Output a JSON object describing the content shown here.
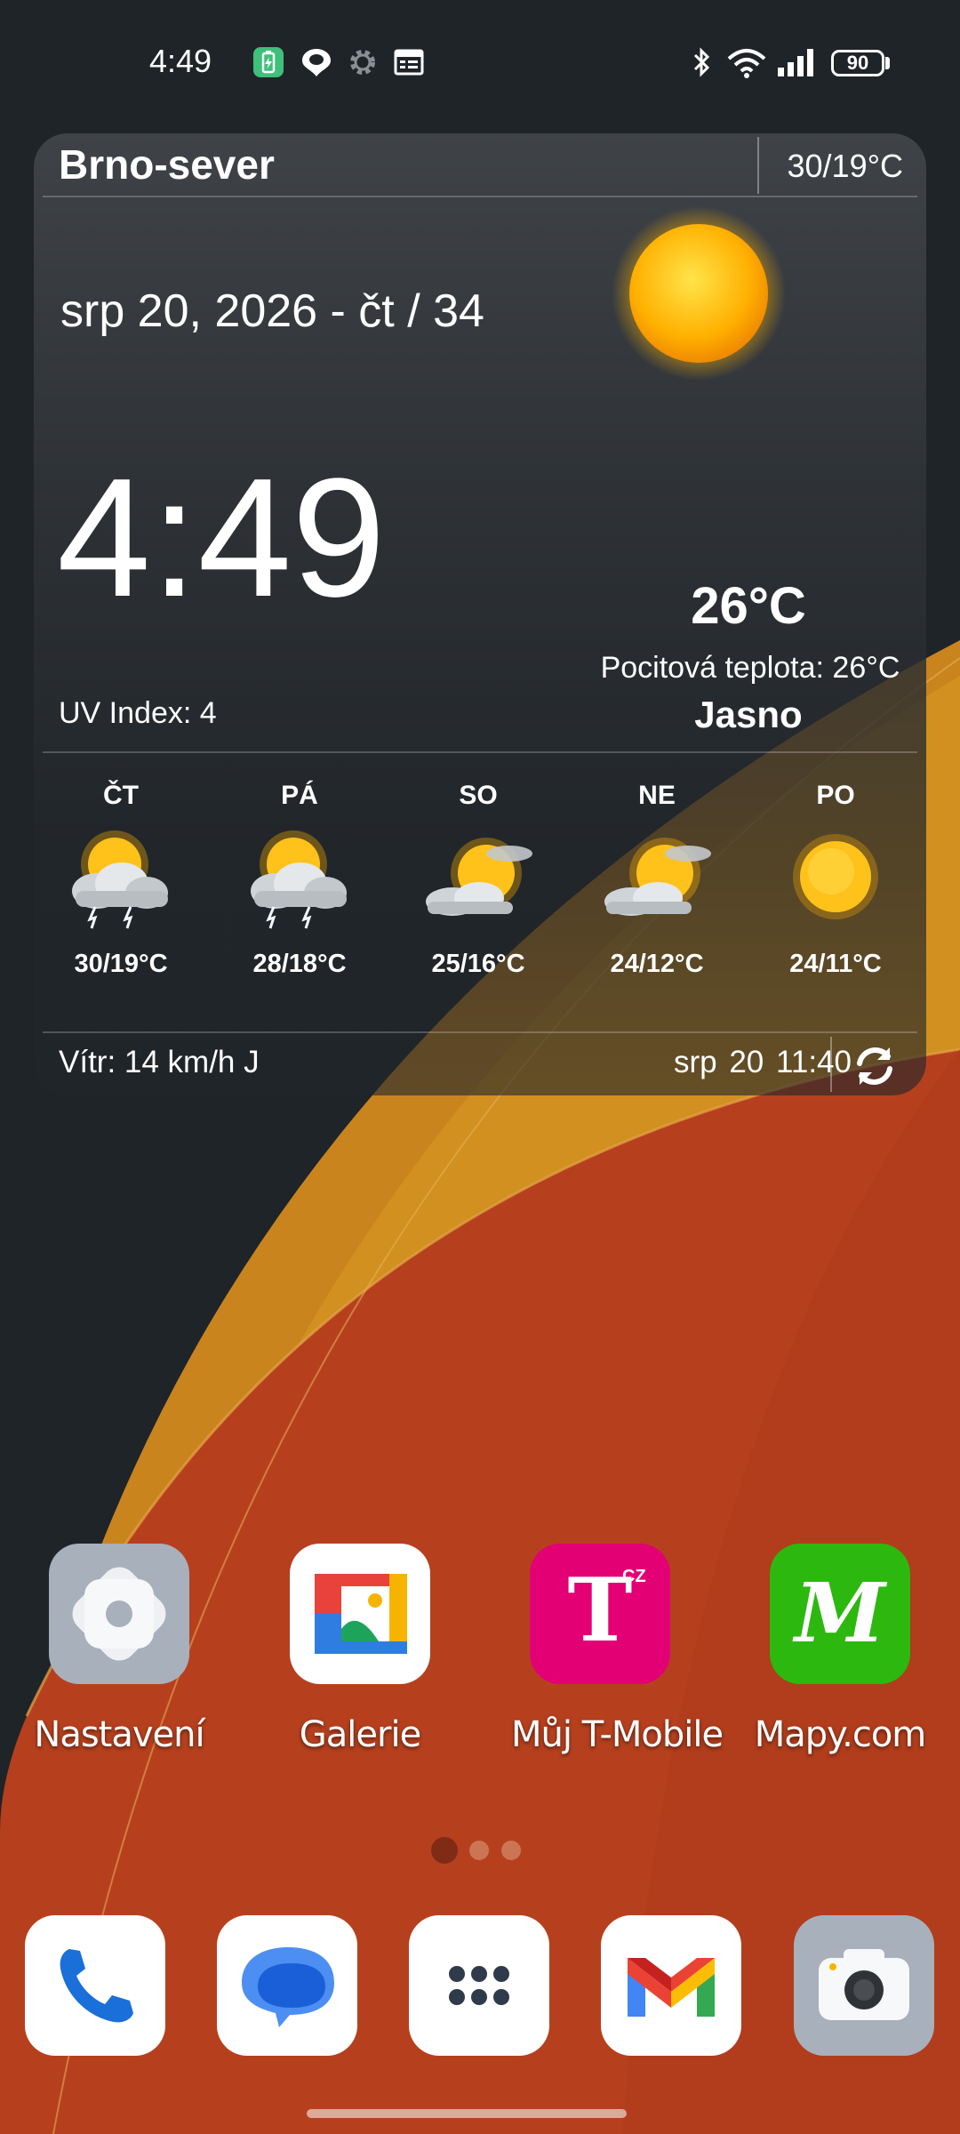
{
  "status_bar": {
    "time": "4:49",
    "left_icons": [
      "battery-saver-icon",
      "location-icon",
      "settings-gear-icon",
      "calendar-icon"
    ],
    "right_icons": [
      "bluetooth-icon",
      "wifi-icon",
      "cell-signal-icon"
    ],
    "battery": "90"
  },
  "weather_widget": {
    "city": "Brno-sever",
    "high_low": "30/19°C",
    "date": "srp 20, 2026 - čt / 34",
    "time": "4:49",
    "temperature": "26°C",
    "feels_like": "Pocitová teplota: 26°C",
    "condition": "Jasno",
    "uv_index": "UV Index: 4",
    "forecast": [
      {
        "day": "ČT",
        "temp": "30/19°C",
        "icon": "storm-sun-icon"
      },
      {
        "day": "PÁ",
        "temp": "28/18°C",
        "icon": "storm-sun-icon"
      },
      {
        "day": "SO",
        "temp": "25/16°C",
        "icon": "partly-cloudy-icon"
      },
      {
        "day": "NE",
        "temp": "24/12°C",
        "icon": "partly-cloudy-icon"
      },
      {
        "day": "PO",
        "temp": "24/11°C",
        "icon": "sun-icon"
      }
    ],
    "wind": "Vítr: 14 km/h J",
    "updated": "srp 20  11:40"
  },
  "home_apps": [
    {
      "label": "Nastavení",
      "icon": "settings-app-icon"
    },
    {
      "label": "Galerie",
      "icon": "gallery-app-icon"
    },
    {
      "label": "Můj T-Mobile",
      "icon": "tmobile-app-icon",
      "logo_text": "T",
      "logo_badge": "CZ"
    },
    {
      "label": "Mapy.com",
      "icon": "mapy-app-icon",
      "logo_text": "M"
    }
  ],
  "page_indicator": {
    "pages": 3,
    "current": 1
  },
  "dock": [
    {
      "name": "phone-app-icon"
    },
    {
      "name": "messages-app-icon"
    },
    {
      "name": "app-drawer-icon"
    },
    {
      "name": "gmail-app-icon"
    },
    {
      "name": "camera-app-icon"
    }
  ],
  "colors": {
    "background": "#1e2428",
    "wallpaper_orange": "#b8401e",
    "wallpaper_gold": "#d4901c",
    "tmobile_magenta": "#e20074",
    "mapy_green": "#2cb80e"
  }
}
